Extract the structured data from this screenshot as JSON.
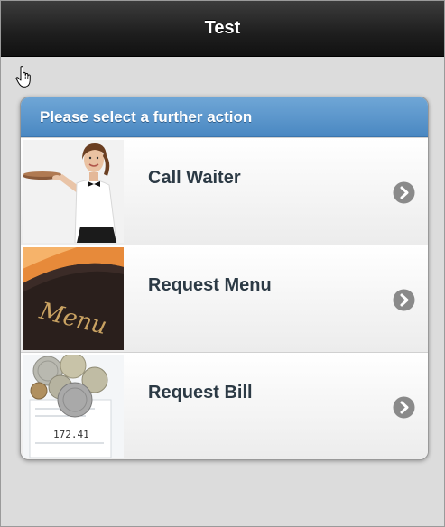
{
  "header": {
    "title": "Test"
  },
  "panel": {
    "heading": "Please select a further action",
    "items": [
      {
        "label": "Call Waiter",
        "image": "waiter-photo"
      },
      {
        "label": "Request Menu",
        "image": "menu-photo",
        "image_text": "Menu"
      },
      {
        "label": "Request Bill",
        "image": "bill-coins-photo",
        "image_text": "172.41"
      }
    ]
  },
  "icons": {
    "cursor": "hand-pointer-icon",
    "row_arrow": "chevron-right-circle-icon"
  },
  "colors": {
    "header_bg": "#1e1e1e",
    "panel_header_bg": "#4a88c2",
    "label_text": "#2c3a45",
    "chevron_bg": "#8a8a8a"
  }
}
